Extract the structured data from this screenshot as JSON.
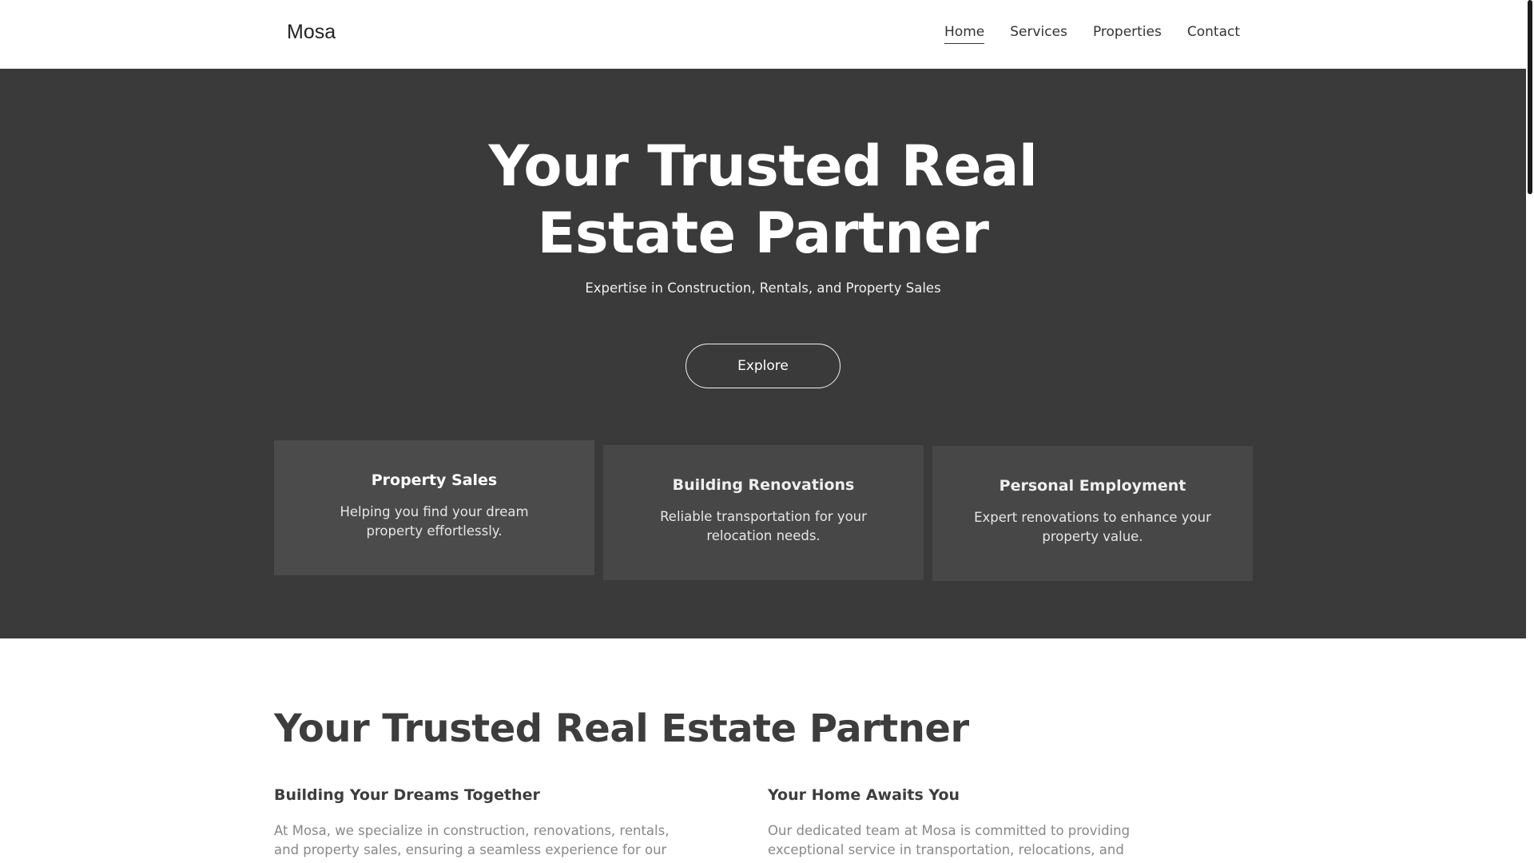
{
  "header": {
    "logo": "Mosa",
    "nav": [
      {
        "label": "Home",
        "active": true
      },
      {
        "label": "Services",
        "active": false
      },
      {
        "label": "Properties",
        "active": false
      },
      {
        "label": "Contact",
        "active": false
      }
    ]
  },
  "hero": {
    "title_line1": "Your Trusted Real",
    "title_line2": "Estate Partner",
    "subtitle": "Expertise in Construction, Rentals, and Property Sales",
    "button_label": "Explore",
    "cards": [
      {
        "title": "Property Sales",
        "text": "Helping you find your dream property effortlessly."
      },
      {
        "title": "Building Renovations",
        "text": "Reliable transportation for your relocation needs."
      },
      {
        "title": "Personal Employment",
        "text": "Expert renovations to enhance your property value."
      }
    ]
  },
  "about": {
    "title": "Your Trusted Real Estate Partner",
    "left": {
      "heading": "Building Your Dreams Together",
      "text": "At Mosa, we specialize in construction, renovations, rentals, and property sales, ensuring a seamless experience for our clients from the initial idea to the final key handover and beyond."
    },
    "right": {
      "heading": "Your Home Awaits You",
      "text": "Our dedicated team at Mosa is committed to providing exceptional service in transportation, relocations, and personalized employment solutions tailored to your needs."
    }
  },
  "colors": {
    "hero_bg": "#3a3a3a",
    "card_bg": "#4a4a4a",
    "text_dark": "#3d3d3d",
    "text_muted": "#888888"
  }
}
